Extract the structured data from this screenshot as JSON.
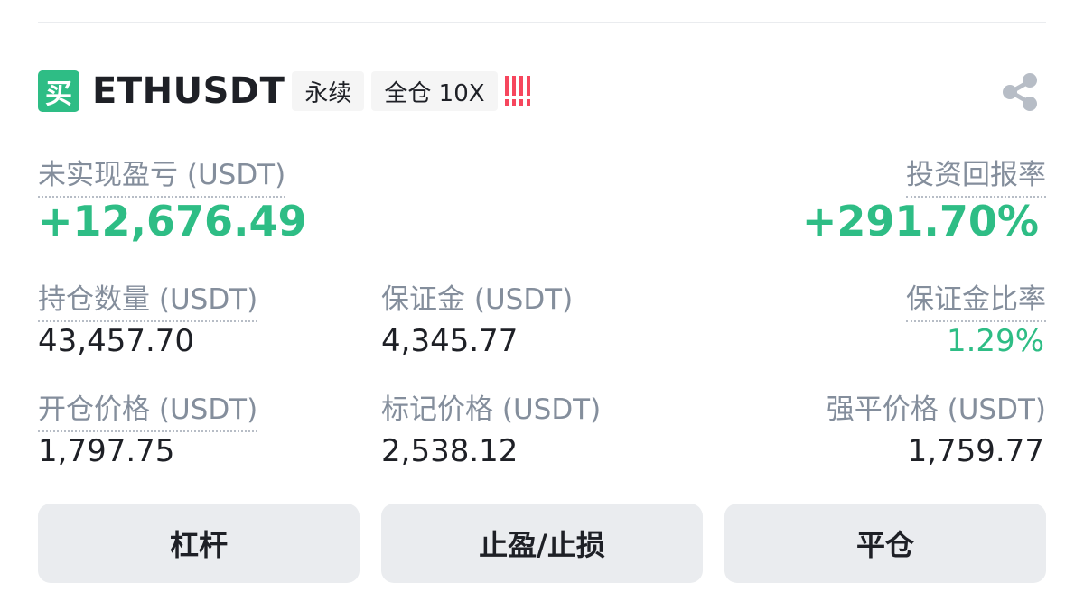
{
  "header": {
    "side_badge": "买",
    "symbol": "ETHUSDT",
    "contract_type": "永续",
    "margin_mode": "全仓 10X",
    "risk_icon": "risk-alert-icon",
    "share_icon": "share-icon"
  },
  "pnl": {
    "label": "未实现盈亏 (USDT)",
    "value": "+12,676.49"
  },
  "roe": {
    "label": "投资回报率",
    "value": "+291.70%"
  },
  "position_size": {
    "label": "持仓数量 (USDT)",
    "value": "43,457.70"
  },
  "margin": {
    "label": "保证金 (USDT)",
    "value": "4,345.77"
  },
  "margin_ratio": {
    "label": "保证金比率",
    "value": "1.29%"
  },
  "entry_price": {
    "label": "开仓价格 (USDT)",
    "value": "1,797.75"
  },
  "mark_price": {
    "label": "标记价格 (USDT)",
    "value": "2,538.12"
  },
  "liq_price": {
    "label": "强平价格 (USDT)",
    "value": "1,759.77"
  },
  "buttons": {
    "leverage": "杠杆",
    "tpsl": "止盈/止损",
    "close": "平仓"
  },
  "colors": {
    "positive": "#2ebd85",
    "risk": "#f6465d",
    "label": "#848e9c"
  }
}
